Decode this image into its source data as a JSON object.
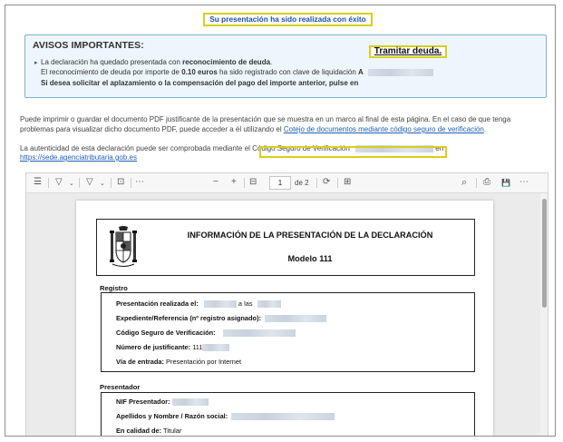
{
  "success_message": "Su presentación ha sido realizada con éxito",
  "notice": {
    "title": "AVISOS IMPORTANTES:",
    "line1_prefix": "La declaración ha quedado presentada con ",
    "line1_bold": "reconocimiento de deuda",
    "line1_suffix": ".",
    "line2_prefix": "El reconocimiento de deuda por importe de ",
    "line2_amount": "0.10 euros",
    "line2_suffix": " ha sido registrado con clave de liquidación ",
    "line2_key": "A",
    "line3": "Si desea solicitar el aplazamiento o la compensación del pago del importe anterior, pulse en",
    "tramitar_link": "Tramitar deuda."
  },
  "info": {
    "p1_line1": "Puede imprimir o guardar el documento PDF justificante de la presentación que se muestra en un marco al final de esta página. En el caso de que tenga",
    "p1_line2_prefix": "problemas para visualizar dicho documento PDF, puede acceder a él utilizando el ",
    "p1_link": "Cotejo de documentos mediante código seguro de verificación",
    "p1_line2_suffix": ".",
    "p2_prefix": "La autenticidad de esta declaración puede ser comprobada mediante el ",
    "p2_csv": "Código Seguro de Verificación",
    "p2_suffix": " en",
    "p2_link": "https://sede.agenciatributaria.gob.es"
  },
  "viewer": {
    "toolbar": {
      "contents": "☰",
      "highlight": "▽",
      "draw": "▽",
      "text": "⊡",
      "more": "⋯",
      "zoom_out": "−",
      "zoom_in": "+",
      "fit": "⊟",
      "page_current": "1",
      "page_total": "de 2",
      "rotate": "⟳",
      "two_page": "⊞",
      "search": "⌕",
      "print": "⎙",
      "save": "💾",
      "more_right": "⋯"
    },
    "page": {
      "title": "INFORMACIÓN DE LA PRESENTACIÓN DE LA DECLARACIÓN",
      "modelo": "Modelo 111",
      "registro": {
        "label": "Registro",
        "fecha_label": "Presentación realizada el:",
        "fecha_sep": "a las",
        "expediente_label": "Expediente/Referencia (nº registro asignado):",
        "csv_label": "Código Seguro de Verificación:",
        "justificante_label": "Número de justificante:",
        "justificante_value": "111",
        "via_label": "Vía de entrada:",
        "via_value": "Presentación por Internet"
      },
      "presentador": {
        "label": "Presentador",
        "nif_label": "NIF Presentador:",
        "nombre_label": "Apellidos y Nombre / Razón social:",
        "calidad_label": "En calidad de:",
        "calidad_value": "Titular"
      }
    }
  }
}
